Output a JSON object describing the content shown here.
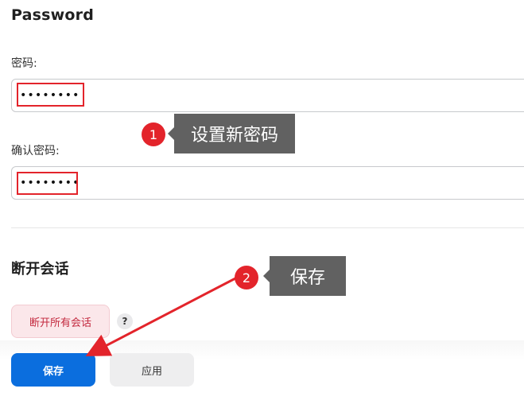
{
  "password_section": {
    "title": "Password",
    "password_label": "密码:",
    "password_value": "••••••••",
    "confirm_label": "确认密码:",
    "confirm_value": "••••••••"
  },
  "sessions_section": {
    "title": "断开会话",
    "disconnect_all_label": "断开所有会话",
    "help_label": "?"
  },
  "actions": {
    "save_label": "保存",
    "apply_label": "应用"
  },
  "annotations": {
    "step1_number": "1",
    "step1_text": "设置新密码",
    "step2_number": "2",
    "step2_text": "保存"
  },
  "colors": {
    "primary": "#0b6ede",
    "danger_text": "#c3293f",
    "danger_bg": "#fbe7ea",
    "annotation_red": "#e3242b",
    "callout_bg": "#616161"
  }
}
